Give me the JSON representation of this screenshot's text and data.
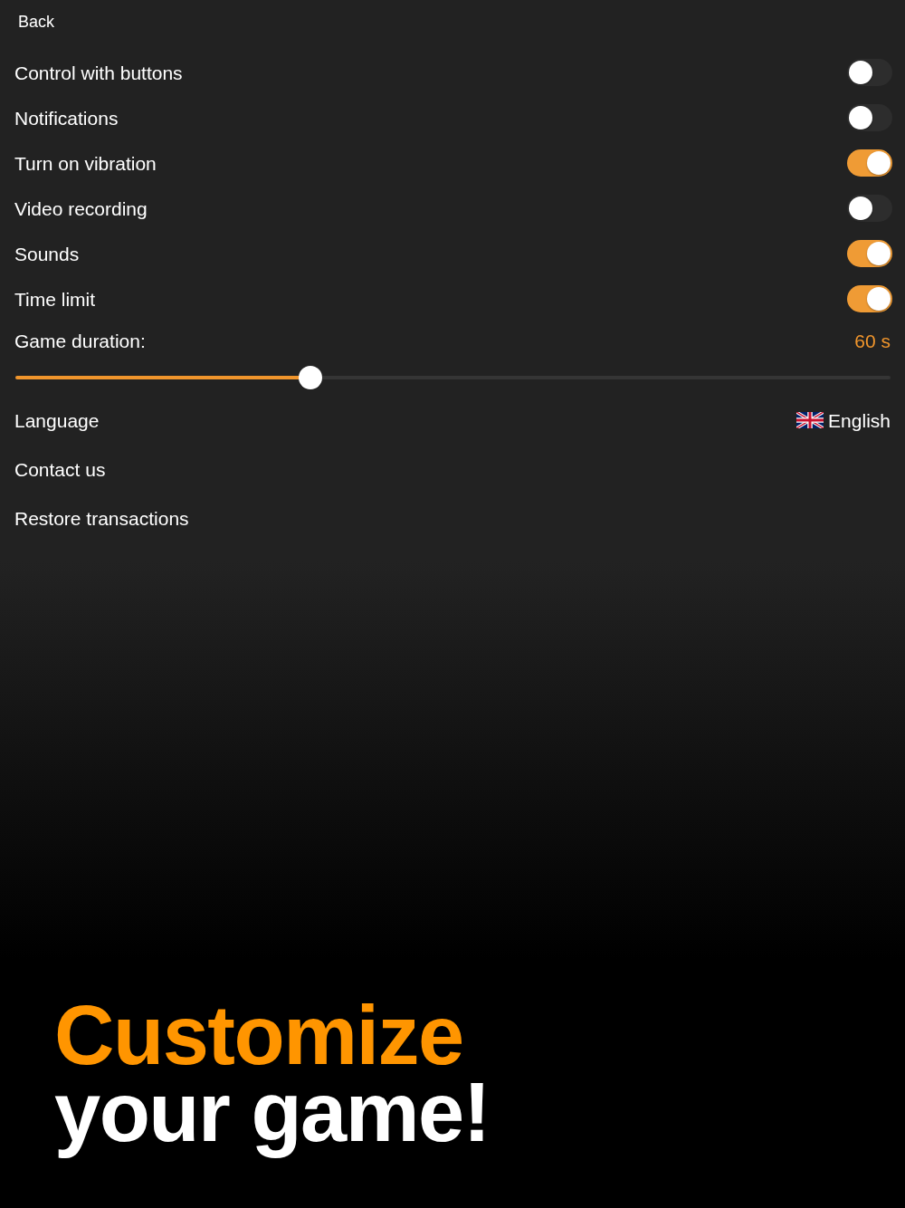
{
  "header": {
    "back": "Back"
  },
  "settings": [
    {
      "label": "Control with buttons",
      "on": false
    },
    {
      "label": "Notifications",
      "on": false
    },
    {
      "label": "Turn on vibration",
      "on": true
    },
    {
      "label": "Video recording",
      "on": false
    },
    {
      "label": "Sounds",
      "on": true
    },
    {
      "label": "Time limit",
      "on": true
    }
  ],
  "duration": {
    "label": "Game duration:",
    "value": "60 s",
    "level": 0.337
  },
  "links": [
    {
      "kind": "language",
      "label": "Language",
      "value": "English"
    },
    {
      "kind": "link",
      "label": "Contact us"
    },
    {
      "kind": "link",
      "label": "Restore transactions"
    }
  ],
  "headline": {
    "line_1": "Customize",
    "line_2": "your game!"
  }
}
